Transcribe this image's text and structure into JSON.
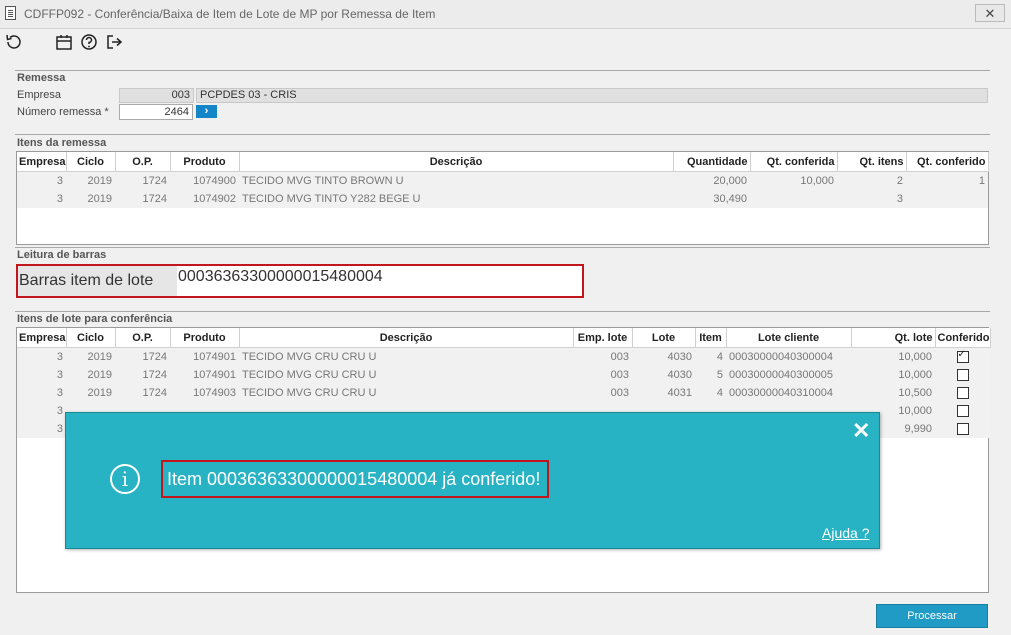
{
  "window": {
    "title": "CDFFP092 - Conferência/Baixa de Item de Lote de MP por Remessa de Item",
    "close_glyph": "✕"
  },
  "toolbar": {
    "icons": [
      "refresh-icon",
      "calendar-icon",
      "help-icon",
      "exit-icon"
    ]
  },
  "remessa": {
    "title": "Remessa",
    "empresa_label": "Empresa",
    "empresa_code": "003",
    "empresa_name": "PCPDES 03 - CRIS",
    "numero_label": "Número remessa *",
    "numero_value": "2464",
    "go_glyph": "›"
  },
  "itens_remessa": {
    "title": "Itens da remessa",
    "columns": [
      "Empresa",
      "Ciclo",
      "O.P.",
      "Produto",
      "Descrição",
      "Quantidade",
      "Qt. conferida",
      "Qt. itens",
      "Qt. conferido"
    ],
    "rows": [
      [
        "3",
        "2019",
        "1724",
        "1074900",
        "TECIDO MVG TINTO BROWN U",
        "20,000",
        "10,000",
        "2",
        "1"
      ],
      [
        "3",
        "2019",
        "1724",
        "1074902",
        "TECIDO MVG TINTO Y282 BEGE U",
        "30,490",
        "",
        "3",
        ""
      ]
    ]
  },
  "leitura": {
    "title": "Leitura de barras",
    "barcode_label": "Barras item de lote",
    "barcode_value": "00036363300000015480004"
  },
  "itens_lote": {
    "title": "Itens de lote para conferência",
    "columns": [
      "Empresa",
      "Ciclo",
      "O.P.",
      "Produto",
      "Descrição",
      "Emp. lote",
      "Lote",
      "Item",
      "Lote cliente",
      "Qt. lote",
      "Conferido"
    ],
    "rows": [
      [
        "3",
        "2019",
        "1724",
        "1074901",
        "TECIDO MVG CRU CRU U",
        "003",
        "4030",
        "4",
        "00030000040300004",
        "10,000",
        true
      ],
      [
        "3",
        "2019",
        "1724",
        "1074901",
        "TECIDO MVG CRU CRU U",
        "003",
        "4030",
        "5",
        "00030000040300005",
        "10,000",
        false
      ],
      [
        "3",
        "2019",
        "1724",
        "1074903",
        "TECIDO MVG CRU CRU U",
        "003",
        "4031",
        "4",
        "00030000040310004",
        "10,500",
        false
      ],
      [
        "3",
        "",
        "",
        "",
        "",
        "",
        "",
        "",
        "",
        "10,000",
        false
      ],
      [
        "3",
        "",
        "",
        "",
        "",
        "",
        "",
        "",
        "",
        "9,990",
        false
      ]
    ]
  },
  "dialog": {
    "message": "Item 00036363300000015480004 já conferido!",
    "help_link": "Ajuda ?",
    "close_glyph": "✕",
    "info_glyph": "i"
  },
  "actions": {
    "process_label": "Processar"
  }
}
